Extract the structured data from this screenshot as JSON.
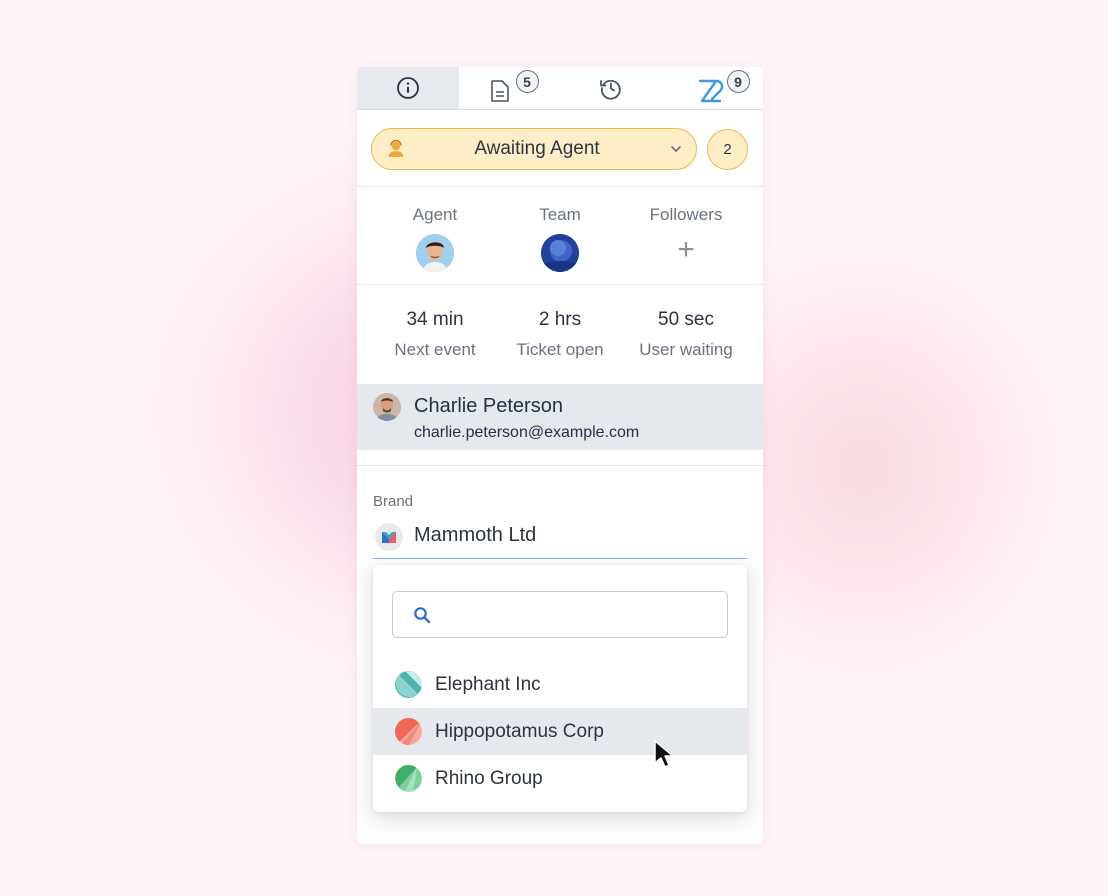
{
  "tabs": [
    {
      "id": "info",
      "icon": "info-icon",
      "badge": ""
    },
    {
      "id": "notes",
      "icon": "document-icon",
      "badge": "5"
    },
    {
      "id": "history",
      "icon": "history-icon",
      "badge": ""
    },
    {
      "id": "linked",
      "icon": "link-brand-icon",
      "badge": "9"
    }
  ],
  "status": {
    "label": "Awaiting Agent",
    "icon": "agent-icon",
    "count": "2",
    "colors": {
      "fill": "#fdeec8",
      "border": "#f2b84b"
    }
  },
  "people": {
    "agent_label": "Agent",
    "team_label": "Team",
    "followers_label": "Followers",
    "add_symbol": "+"
  },
  "metrics": [
    {
      "value": "34 min",
      "caption": "Next event"
    },
    {
      "value": "2 hrs",
      "caption": "Ticket open"
    },
    {
      "value": "50 sec",
      "caption": "User waiting"
    }
  ],
  "requester": {
    "name": "Charlie Peterson",
    "email": "charlie.peterson@example.com"
  },
  "brand": {
    "label": "Brand",
    "value": "Mammoth Ltd",
    "search_placeholder": "",
    "options": [
      {
        "label": "Elephant Inc",
        "icon": "elephant-logo-icon",
        "color": "#4fb3b0"
      },
      {
        "label": "Hippopotamus Corp",
        "icon": "hippo-logo-icon",
        "color": "#ee6a55",
        "hovered": true
      },
      {
        "label": "Rhino Group",
        "icon": "rhino-logo-icon",
        "color": "#3fae6a"
      }
    ]
  },
  "accent_colors": {
    "link_icon": "#3b9be0",
    "underline": "#8fb3df"
  }
}
